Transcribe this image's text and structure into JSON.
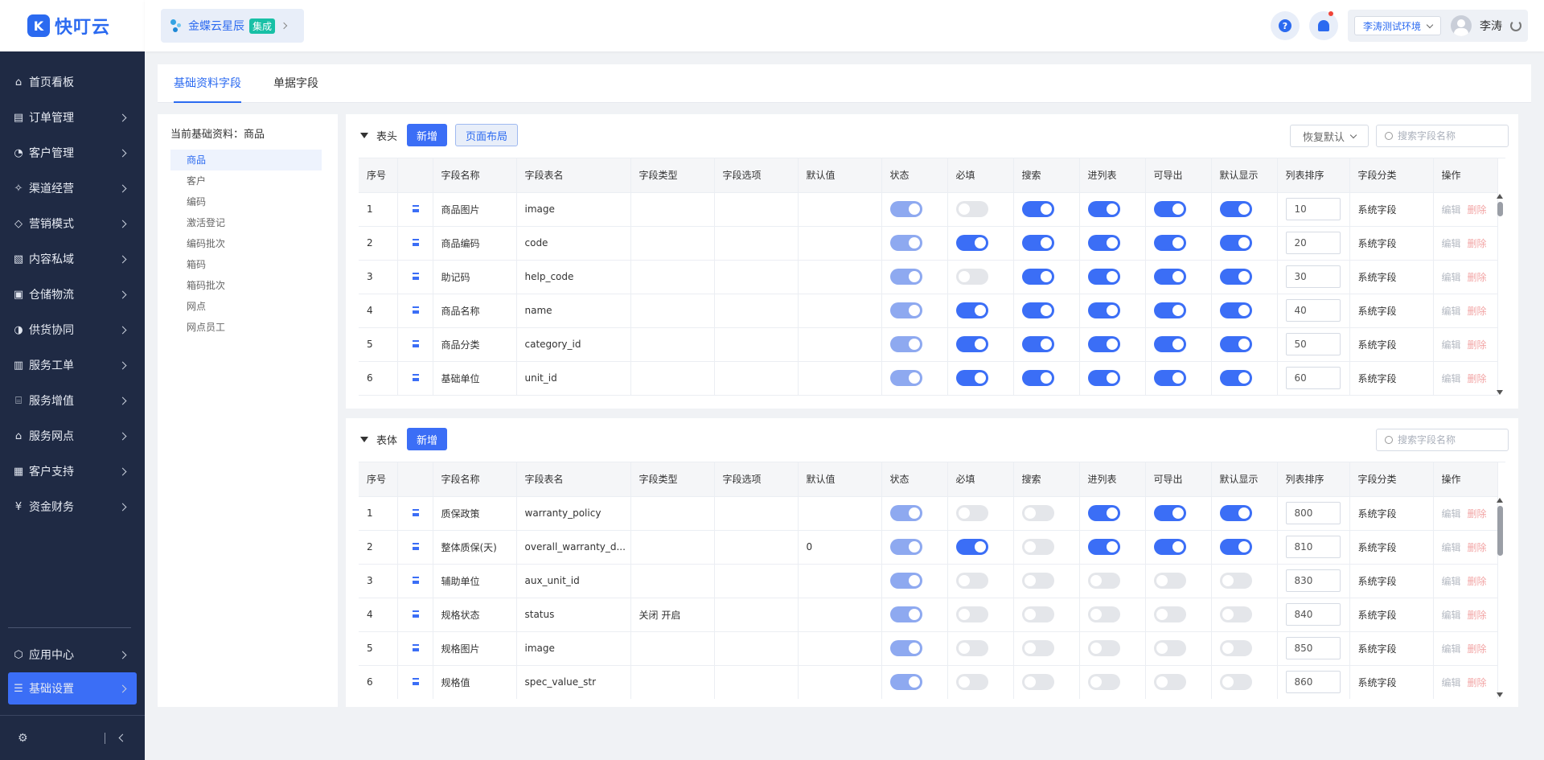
{
  "brand": {
    "name": "快叮云",
    "mark": "K"
  },
  "sidebar": {
    "items": [
      {
        "label": "首页看板",
        "icon": "home-icon",
        "glyph": "⌂",
        "chevron": false
      },
      {
        "label": "订单管理",
        "icon": "clipboard-icon",
        "glyph": "▤",
        "chevron": true
      },
      {
        "label": "客户管理",
        "icon": "user-icon",
        "glyph": "◔",
        "chevron": true
      },
      {
        "label": "渠道经营",
        "icon": "share-icon",
        "glyph": "✧",
        "chevron": true
      },
      {
        "label": "营销模式",
        "icon": "tag-icon",
        "glyph": "◇",
        "chevron": true
      },
      {
        "label": "内容私域",
        "icon": "image-icon",
        "glyph": "▧",
        "chevron": true
      },
      {
        "label": "仓储物流",
        "icon": "box-icon",
        "glyph": "▣",
        "chevron": true
      },
      {
        "label": "供货协同",
        "icon": "users-icon",
        "glyph": "◑",
        "chevron": true
      },
      {
        "label": "服务工单",
        "icon": "ticket-icon",
        "glyph": "▥",
        "chevron": true
      },
      {
        "label": "服务增值",
        "icon": "bag-icon",
        "glyph": "⌸",
        "chevron": true
      },
      {
        "label": "服务网点",
        "icon": "store-icon",
        "glyph": "⌂",
        "chevron": true
      },
      {
        "label": "客户支持",
        "icon": "support-icon",
        "glyph": "▦",
        "chevron": true
      },
      {
        "label": "资金财务",
        "icon": "yen-icon",
        "glyph": "¥",
        "chevron": true
      }
    ],
    "bottom": [
      {
        "label": "应用中心",
        "icon": "cube-icon",
        "glyph": "⬡",
        "active": false
      },
      {
        "label": "基础设置",
        "icon": "sliders-icon",
        "glyph": "☰",
        "active": true
      }
    ]
  },
  "header": {
    "app_name": "金蝶云星辰",
    "app_badge": "集成",
    "help_glyph": "?",
    "env": "李涛测试环境",
    "user": "李涛"
  },
  "tabs": [
    {
      "label": "基础资料字段",
      "active": true
    },
    {
      "label": "单据字段",
      "active": false
    }
  ],
  "left_panel": {
    "title": "当前基础资料：商品",
    "items": [
      "商品",
      "客户",
      "编码",
      "激活登记",
      "编码批次",
      "箱码",
      "箱码批次",
      "网点",
      "网点员工"
    ],
    "selected": 0
  },
  "columns": [
    "序号",
    "",
    "字段名称",
    "字段表名",
    "字段类型",
    "字段选项",
    "默认值",
    "状态",
    "必填",
    "搜索",
    "进列表",
    "可导出",
    "默认显示",
    "列表排序",
    "字段分类",
    "操作"
  ],
  "ops": {
    "edit": "编辑",
    "delete": "删除"
  },
  "header_section": {
    "title": "表头",
    "add_label": "新增",
    "layout_label": "页面布局",
    "restore_label": "恢复默认",
    "search_placeholder": "搜索字段名称",
    "rows": [
      {
        "no": "1",
        "name": "商品图片",
        "table": "image",
        "type": "",
        "options": "",
        "default": "",
        "status": "dim",
        "required": "off",
        "search": "on",
        "in_list": "on",
        "export": "on",
        "show": "on",
        "sort": "10",
        "category": "系统字段"
      },
      {
        "no": "2",
        "name": "商品编码",
        "table": "code",
        "type": "",
        "options": "",
        "default": "",
        "status": "dim",
        "required": "on",
        "search": "on",
        "in_list": "on",
        "export": "on",
        "show": "on",
        "sort": "20",
        "category": "系统字段"
      },
      {
        "no": "3",
        "name": "助记码",
        "table": "help_code",
        "type": "",
        "options": "",
        "default": "",
        "status": "dim",
        "required": "off",
        "search": "on",
        "in_list": "on",
        "export": "on",
        "show": "on",
        "sort": "30",
        "category": "系统字段"
      },
      {
        "no": "4",
        "name": "商品名称",
        "table": "name",
        "type": "",
        "options": "",
        "default": "",
        "status": "dim",
        "required": "on",
        "search": "on",
        "in_list": "on",
        "export": "on",
        "show": "on",
        "sort": "40",
        "category": "系统字段"
      },
      {
        "no": "5",
        "name": "商品分类",
        "table": "category_id",
        "type": "",
        "options": "",
        "default": "",
        "status": "dim",
        "required": "on",
        "search": "on",
        "in_list": "on",
        "export": "on",
        "show": "on",
        "sort": "50",
        "category": "系统字段"
      },
      {
        "no": "6",
        "name": "基础单位",
        "table": "unit_id",
        "type": "",
        "options": "",
        "default": "",
        "status": "dim",
        "required": "on",
        "search": "on",
        "in_list": "on",
        "export": "on",
        "show": "on",
        "sort": "60",
        "category": "系统字段"
      }
    ]
  },
  "body_section": {
    "title": "表体",
    "add_label": "新增",
    "search_placeholder": "搜索字段名称",
    "rows": [
      {
        "no": "1",
        "name": "质保政策",
        "table": "warranty_policy",
        "type": "",
        "options": "",
        "default": "",
        "status": "dim",
        "required": "off",
        "search": "off",
        "in_list": "on",
        "export": "on",
        "show": "on",
        "sort": "800",
        "category": "系统字段"
      },
      {
        "no": "2",
        "name": "整体质保(天)",
        "table": "overall_warranty_d...",
        "type": "",
        "options": "",
        "default": "0",
        "status": "dim",
        "required": "on",
        "search": "off",
        "in_list": "on",
        "export": "on",
        "show": "on",
        "sort": "810",
        "category": "系统字段"
      },
      {
        "no": "3",
        "name": "辅助单位",
        "table": "aux_unit_id",
        "type": "",
        "options": "",
        "default": "",
        "status": "dim",
        "required": "off",
        "search": "off",
        "in_list": "off",
        "export": "off",
        "show": "off",
        "sort": "830",
        "category": "系统字段"
      },
      {
        "no": "4",
        "name": "规格状态",
        "table": "status",
        "type": "关闭 开启",
        "options": "",
        "default": "",
        "status": "dim",
        "required": "off",
        "search": "off",
        "in_list": "off",
        "export": "off",
        "show": "off",
        "sort": "840",
        "category": "系统字段"
      },
      {
        "no": "5",
        "name": "规格图片",
        "table": "image",
        "type": "",
        "options": "",
        "default": "",
        "status": "dim",
        "required": "off",
        "search": "off",
        "in_list": "off",
        "export": "off",
        "show": "off",
        "sort": "850",
        "category": "系统字段"
      },
      {
        "no": "6",
        "name": "规格值",
        "table": "spec_value_str",
        "type": "",
        "options": "",
        "default": "",
        "status": "dim",
        "required": "off",
        "search": "off",
        "in_list": "off",
        "export": "off",
        "show": "off",
        "sort": "860",
        "category": "系统字段"
      }
    ]
  },
  "colors": {
    "accent": "#3b6ef6",
    "sidebar_bg": "#1f2a44",
    "success": "#18c0a6"
  }
}
